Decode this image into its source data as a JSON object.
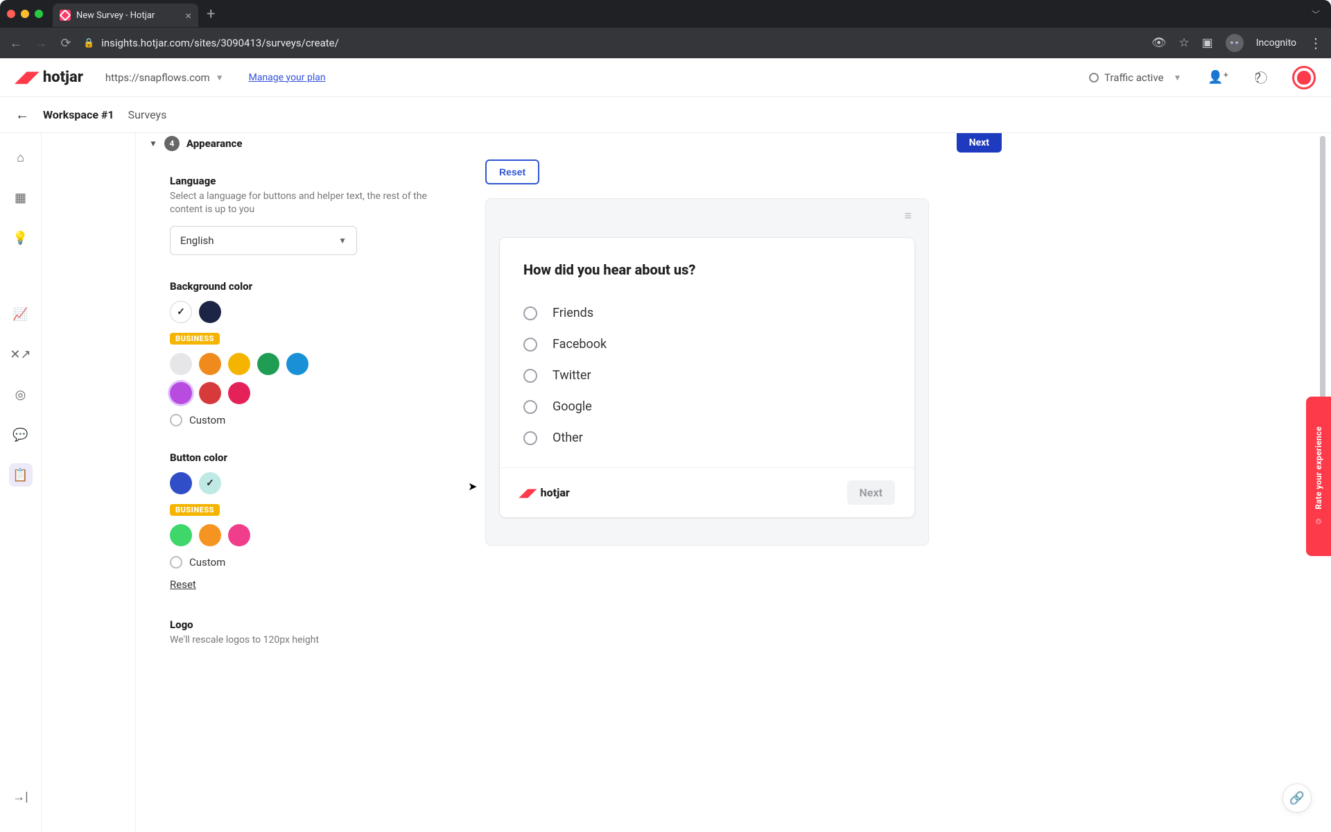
{
  "browser": {
    "tab_title": "New Survey - Hotjar",
    "url": "insights.hotjar.com/sites/3090413/surveys/create/",
    "incognito_label": "Incognito"
  },
  "header": {
    "brand": "hotjar",
    "site": "https://snapflows.com",
    "manage_plan": "Manage your plan",
    "traffic_label": "Traffic active"
  },
  "crumb": {
    "workspace": "Workspace #1",
    "section": "Surveys"
  },
  "appearance": {
    "step_num": "4",
    "title": "Appearance",
    "next_label": "Next",
    "language": {
      "label": "Language",
      "hint": "Select a language for buttons and helper text, the rest of the content is up to you",
      "value": "English"
    },
    "bg": {
      "label": "Background color",
      "business_tag": "BUSINESS",
      "custom_label": "Custom"
    },
    "btn": {
      "label": "Button color",
      "business_tag": "BUSINESS",
      "custom_label": "Custom",
      "reset_label": "Reset"
    },
    "logo": {
      "label": "Logo",
      "hint": "We'll rescale logos to 120px height"
    }
  },
  "preview": {
    "reset_label": "Reset",
    "question": "How did you hear about us?",
    "options": [
      "Friends",
      "Facebook",
      "Twitter",
      "Google",
      "Other"
    ],
    "footer_brand": "hotjar",
    "next_label": "Next"
  },
  "feedback_tab": "Rate your experience"
}
